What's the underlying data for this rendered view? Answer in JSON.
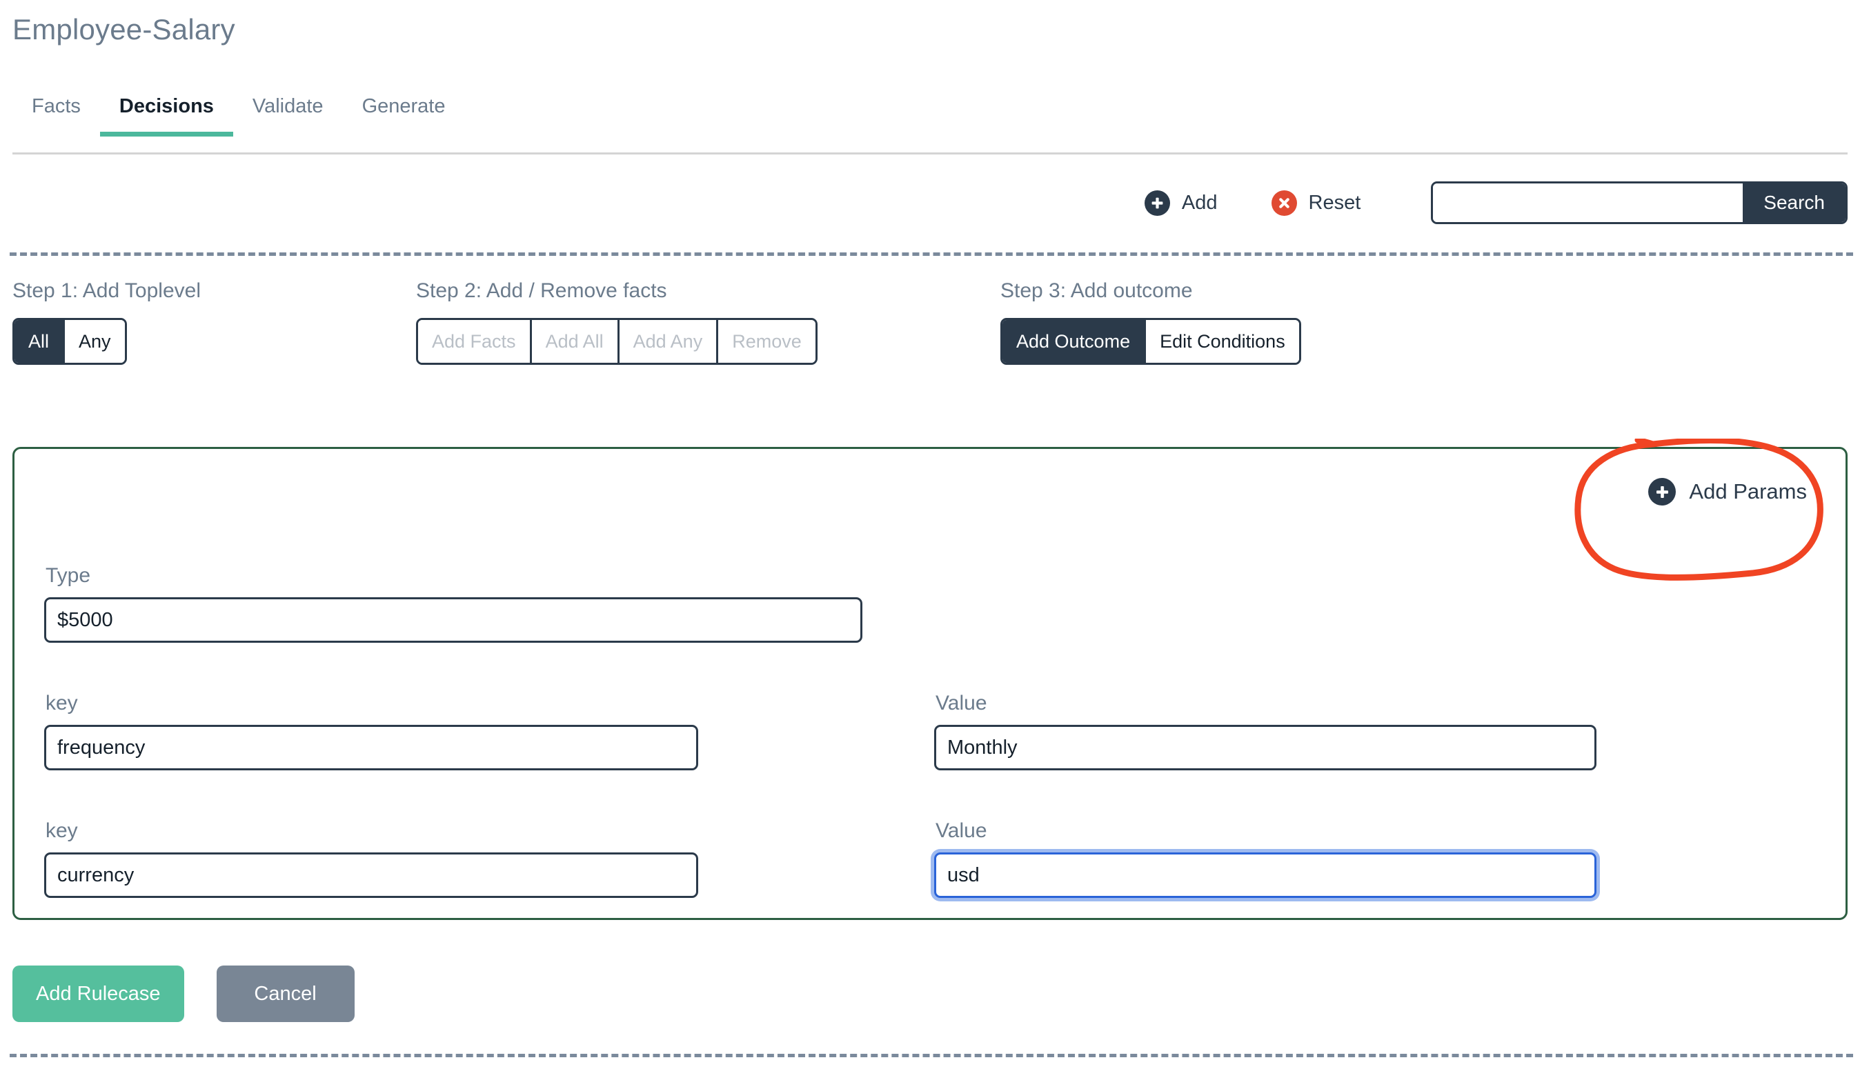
{
  "header": {
    "title": "Employee-Salary"
  },
  "tabs": [
    {
      "label": "Facts",
      "active": false
    },
    {
      "label": "Decisions",
      "active": true
    },
    {
      "label": "Validate",
      "active": false
    },
    {
      "label": "Generate",
      "active": false
    }
  ],
  "toolbar": {
    "add_label": "Add",
    "add_icon": "plus-circle-icon",
    "reset_label": "Reset",
    "reset_icon": "close-circle-icon",
    "search_value": "",
    "search_placeholder": "",
    "search_button_label": "Search"
  },
  "steps": [
    {
      "label": "Step 1: Add Toplevel",
      "buttons": [
        {
          "label": "All",
          "selected": true,
          "disabled": false
        },
        {
          "label": "Any",
          "selected": false,
          "disabled": false
        }
      ]
    },
    {
      "label": "Step 2: Add / Remove facts",
      "buttons": [
        {
          "label": "Add Facts",
          "selected": false,
          "disabled": true
        },
        {
          "label": "Add All",
          "selected": false,
          "disabled": true
        },
        {
          "label": "Add Any",
          "selected": false,
          "disabled": true
        },
        {
          "label": "Remove",
          "selected": false,
          "disabled": true
        }
      ]
    },
    {
      "label": "Step 3: Add outcome",
      "buttons": [
        {
          "label": "Add Outcome",
          "selected": true,
          "disabled": false
        },
        {
          "label": "Edit Conditions",
          "selected": false,
          "disabled": false
        }
      ]
    }
  ],
  "card": {
    "add_params_label": "Add Params",
    "add_params_icon": "plus-circle-icon",
    "type_label": "Type",
    "type_value": "$5000",
    "params": [
      {
        "key_label": "key",
        "key_value": "frequency",
        "value_label": "Value",
        "value_value": "Monthly",
        "value_focused": false
      },
      {
        "key_label": "key",
        "key_value": "currency",
        "value_label": "Value",
        "value_value": "usd",
        "value_focused": true
      }
    ]
  },
  "footer": {
    "submit_label": "Add Rulecase",
    "cancel_label": "Cancel"
  },
  "annotation": {
    "shape": "hand-drawn-red-ellipse",
    "target": "Add Params",
    "color": "#f04423"
  },
  "colors": {
    "accent_teal": "#4cb89c",
    "dark_navy": "#2b3a4a",
    "reset_red": "#e04a32",
    "card_border_green": "#2d5f43",
    "primary_green": "#55bf9d",
    "muted_grey": "#798695",
    "label_grey": "#6b7b8c",
    "focus_blue": "#2a63d8",
    "annotation_red": "#f04423"
  }
}
